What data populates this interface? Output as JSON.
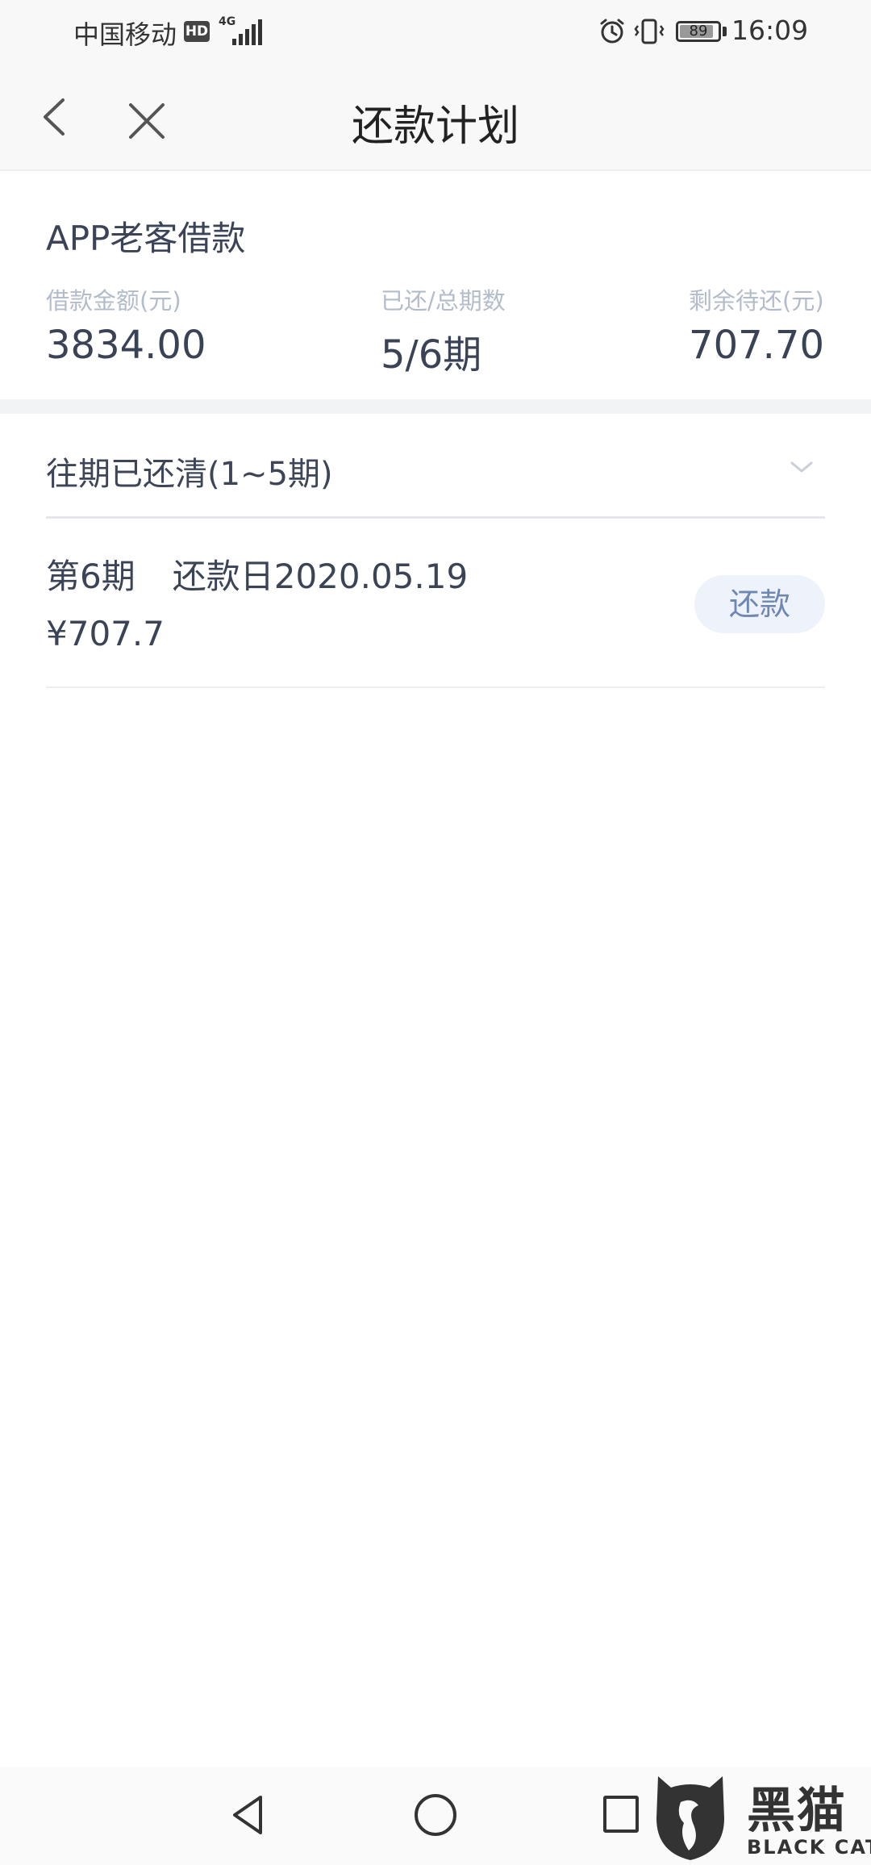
{
  "status_bar": {
    "carrier": "中国移动",
    "hd": "HD",
    "network": "4G",
    "battery": "89",
    "battery_level": 0.89,
    "time": "16:09",
    "icons": [
      "hd-icon",
      "signal-icon",
      "alarm-icon",
      "vibrate-icon",
      "battery-icon"
    ]
  },
  "nav": {
    "title": "还款计划",
    "icons": [
      "back-icon",
      "close-icon"
    ]
  },
  "summary": {
    "product_name": "APP老客借款",
    "loan_amount_label": "借款金额(元)",
    "loan_amount": "3834.00",
    "progress_label": "已还/总期数",
    "progress": "5/6期",
    "remaining_label": "剩余待还(元)",
    "remaining": "707.70"
  },
  "past": {
    "label": "往期已还清(1~5期)",
    "icon": "chevron-down-icon"
  },
  "current_period": {
    "period": "第6期",
    "due_date": "还款日2020.05.19",
    "amount": "¥707.7",
    "repay_label": "还款"
  },
  "system_nav": {
    "icons": [
      "nav-back-icon",
      "nav-home-icon",
      "nav-recent-icon"
    ]
  },
  "watermark": {
    "cn": "黑猫",
    "en": "BLACK CAT"
  },
  "colors": {
    "accent": "#6e87b3",
    "button_bg": "#eef3fb",
    "label_gray": "#b3bccb",
    "text_dark": "#3b4357"
  }
}
